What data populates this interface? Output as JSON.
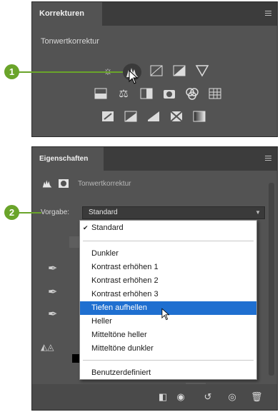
{
  "panel_adjustments": {
    "tab_title": "Korrekturen",
    "subtitle": "Tonwertkorrektur",
    "icons_row1": [
      "brightness-icon",
      "levels-icon",
      "curves-icon",
      "exposure-icon",
      "vibrance-icon"
    ],
    "icons_row2": [
      "hue-saturation-icon",
      "color-balance-icon",
      "black-white-icon",
      "photo-filter-icon",
      "channel-mixer-icon",
      "color-lookup-icon"
    ],
    "icons_row3": [
      "invert-icon",
      "posterize-icon",
      "threshold-icon",
      "selective-color-icon",
      "gradient-map-icon"
    ]
  },
  "panel_properties": {
    "tab_title": "Eigenschaften",
    "header_label": "Tonwertkorrektur",
    "preset_label": "Vorgabe:",
    "preset_value": "Standard"
  },
  "dropdown": {
    "items": [
      {
        "label": "Standard",
        "checked": true
      },
      {
        "label": "Dunkler"
      },
      {
        "label": "Kontrast erhöhen 1"
      },
      {
        "label": "Kontrast erhöhen 2"
      },
      {
        "label": "Kontrast erhöhen 3"
      },
      {
        "label": "Tiefen aufhellen",
        "selected": true
      },
      {
        "label": "Heller"
      },
      {
        "label": "Mitteltöne heller"
      },
      {
        "label": "Mitteltöne dunkler"
      },
      {
        "label": "Benutzerdefiniert"
      }
    ]
  },
  "callouts": {
    "one": "1",
    "two": "2"
  },
  "colors": {
    "accent_green": "#6aa42a",
    "selection_blue": "#1f6fd0",
    "panel_bg": "#535353"
  }
}
